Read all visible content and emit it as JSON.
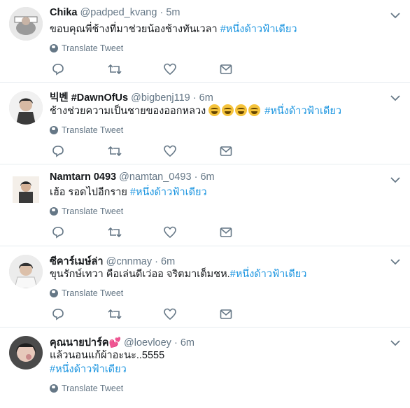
{
  "tweets": [
    {
      "name": "Chika",
      "handle": "@padped_kvang",
      "time": "5m",
      "text_parts": [
        "ขอบคุณพี่ช้างที่มาช่วยน้องช้างทันเวลา ",
        "#หนึ่งด้าวฟ้าเดียว"
      ],
      "translate": "Translate Tweet",
      "avatar_color": "#cfcfcf"
    },
    {
      "name": "빅벤 #DawnOfUs",
      "handle": "@bigbenj119",
      "time": "6m",
      "text_parts": [
        "ช้างช่วยความเป็นชายของออกหลวง ",
        "#หนึ่งด้าวฟ้าเดียว"
      ],
      "translate": "Translate Tweet",
      "avatar_color": "#b9b9b9"
    },
    {
      "name": "Namtarn 0493",
      "handle": "@namtan_0493",
      "time": "6m",
      "text_parts": [
        "เฮ้อ รอดไปอีกราย ",
        "#หนึ่งด้าวฟ้าเดียว"
      ],
      "translate": "Translate Tweet",
      "avatar_color": "#e9e4de"
    },
    {
      "name": "ซีคาร์เมษ์ล่า",
      "handle": "@cnnmay",
      "time": "6m",
      "text_parts": [
        "ขุนรักษ์เทวา  คือเล่นดีเว่ออ จริตมาเต็มชห.",
        "#หนึ่งด้าวฟ้าเดียว"
      ],
      "translate": "Translate Tweet",
      "avatar_color": "#dedede"
    },
    {
      "name": "คุณนายปาร์ค",
      "handle": "@loevloey",
      "time": "6m",
      "text_line1": "แล้วนอนแก้ผ้าอะนะ..5555",
      "text_line2": "#หนึ่งด้าวฟ้าเดียว",
      "translate": "Translate Tweet",
      "avatar_color": "#6b6b6b"
    }
  ],
  "icons": {
    "reply": "reply-icon",
    "retweet": "retweet-icon",
    "like": "like-icon",
    "message": "direct-message-icon",
    "caret": "chevron-down-icon",
    "globe": "globe-icon"
  },
  "colors": {
    "hashtag": "#1b95e0",
    "muted": "#657786",
    "divider": "#e6ecf0"
  }
}
